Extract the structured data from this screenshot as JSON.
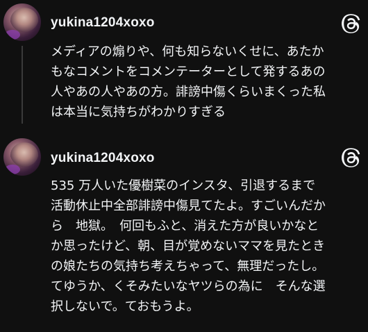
{
  "posts": [
    {
      "username": "yukina1204xoxo",
      "text": "メディアの煽りや、何も知らないくせに、あたか\nもなコメントをコメンテーターとして発するあの\n人やあの人やあの方。誹謗中傷くらいまくった私\nは本当に気持ちがわかりすぎる",
      "avatar_icon": "profile-avatar",
      "menu_icon": "threads-logo-icon"
    },
    {
      "username": "yukina1204xoxo",
      "text": "535 万人いた優樹菜のインスタ、引退するまで\n活動休止中全部誹謗中傷見てたよ。すごいんだか\nら　地獄。　何回もふと、消えた方が良いかなと\nか思ったけど、朝、目が覚めないママを見たとき\nの娘たちの気持ち考えちゃって、無理だったし。\nてゆうか、くそみたいなヤツらの為に　そんな選\n択しないで。ておもうよ。",
      "avatar_icon": "profile-avatar",
      "menu_icon": "threads-logo-icon"
    }
  ],
  "colors": {
    "background": "#101010",
    "text": "#f3f5f7",
    "thread_line": "#3a3a3a"
  }
}
